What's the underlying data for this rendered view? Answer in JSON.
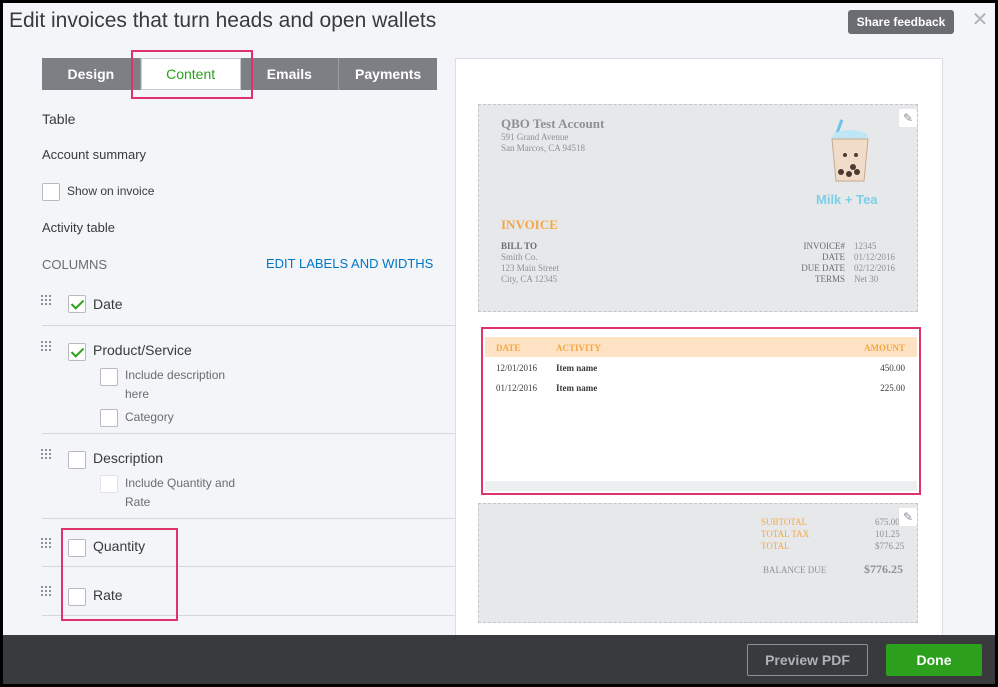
{
  "dialog": {
    "title": "Edit invoices that turn heads and open wallets",
    "feedback_label": "Share feedback",
    "close_glyph": "✕"
  },
  "tabs": [
    {
      "label": "Design"
    },
    {
      "label": "Content"
    },
    {
      "label": "Emails"
    },
    {
      "label": "Payments"
    }
  ],
  "content": {
    "section_table": "Table",
    "account_summary": "Account summary",
    "show_on_invoice": "Show on invoice",
    "activity_table": "Activity table",
    "columns_heading": "COLUMNS",
    "edit_labels_link": "EDIT LABELS AND WIDTHS",
    "columns": {
      "date": {
        "label": "Date",
        "checked": true
      },
      "product_service": {
        "label": "Product/Service",
        "checked": true
      },
      "include_description": "Include description here",
      "category": "Category",
      "description": {
        "label": "Description",
        "checked": false
      },
      "include_qty_rate": "Include Quantity and Rate",
      "quantity": {
        "label": "Quantity",
        "checked": false
      },
      "rate": {
        "label": "Rate",
        "checked": false
      }
    }
  },
  "invoice": {
    "company": "QBO Test Account",
    "address1": "591 Grand Avenue",
    "address2": "San Marcos, CA 94518",
    "logo_text": "Milk + Tea",
    "title": "INVOICE",
    "bill_to_label": "BILL TO",
    "bill_to": [
      "Smith Co.",
      "123 Main Street",
      "City, CA 12345"
    ],
    "meta": [
      {
        "label": "INVOICE#",
        "value": "12345"
      },
      {
        "label": "DATE",
        "value": "01/12/2016"
      },
      {
        "label": "DUE DATE",
        "value": "02/12/2016"
      },
      {
        "label": "TERMS",
        "value": "Net 30"
      }
    ],
    "table_headers": {
      "date": "DATE",
      "activity": "ACTIVITY",
      "amount": "AMOUNT"
    },
    "rows": [
      {
        "date": "12/01/2016",
        "activity": "Item name",
        "amount": "450.00"
      },
      {
        "date": "01/12/2016",
        "activity": "Item name",
        "amount": "225.00"
      }
    ],
    "totals": {
      "subtotal_label": "SUBTOTAL",
      "subtotal": "675.00",
      "tax_label": "TOTAL TAX",
      "tax": "101.25",
      "total_label": "TOTAL",
      "total": "$776.25",
      "balance_label": "BALANCE DUE",
      "balance": "$776.25"
    },
    "accent_color": "#f5a742"
  },
  "footer": {
    "preview_label": "Preview PDF",
    "done_label": "Done"
  }
}
